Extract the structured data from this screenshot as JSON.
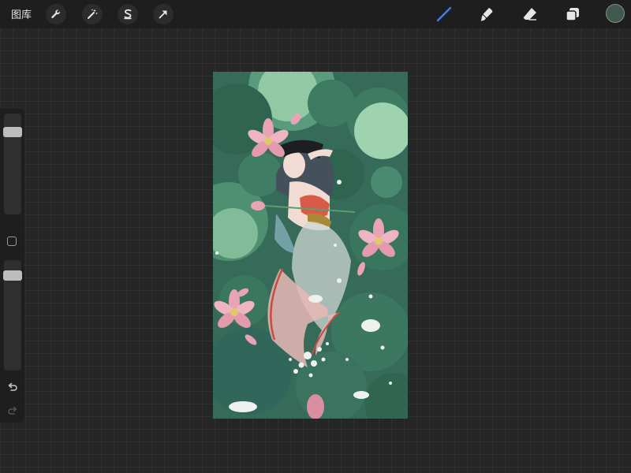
{
  "topbar": {
    "gallery_label": "图库",
    "left_tools": [
      "wrench-icon",
      "magic-wand-icon",
      "selection-icon",
      "transform-arrow-icon"
    ],
    "right_tools": [
      "brush-icon",
      "smudge-icon",
      "eraser-icon",
      "layers-icon"
    ],
    "active_tool": "brush-icon",
    "active_color": "#3f5a4c",
    "accent": "#3d7cf5"
  },
  "sidebar": {
    "brush_size": 0.15,
    "opacity": 0.1,
    "items": [
      "size-slider",
      "modify-button",
      "opacity-slider",
      "undo-button",
      "redo-button"
    ]
  },
  "canvas": {
    "subject": "artwork"
  },
  "colors": {
    "background": "#262626",
    "toolbar": "#1e1e1e",
    "canvas_base": "#356b58",
    "lotus": "#e8a3b4"
  }
}
